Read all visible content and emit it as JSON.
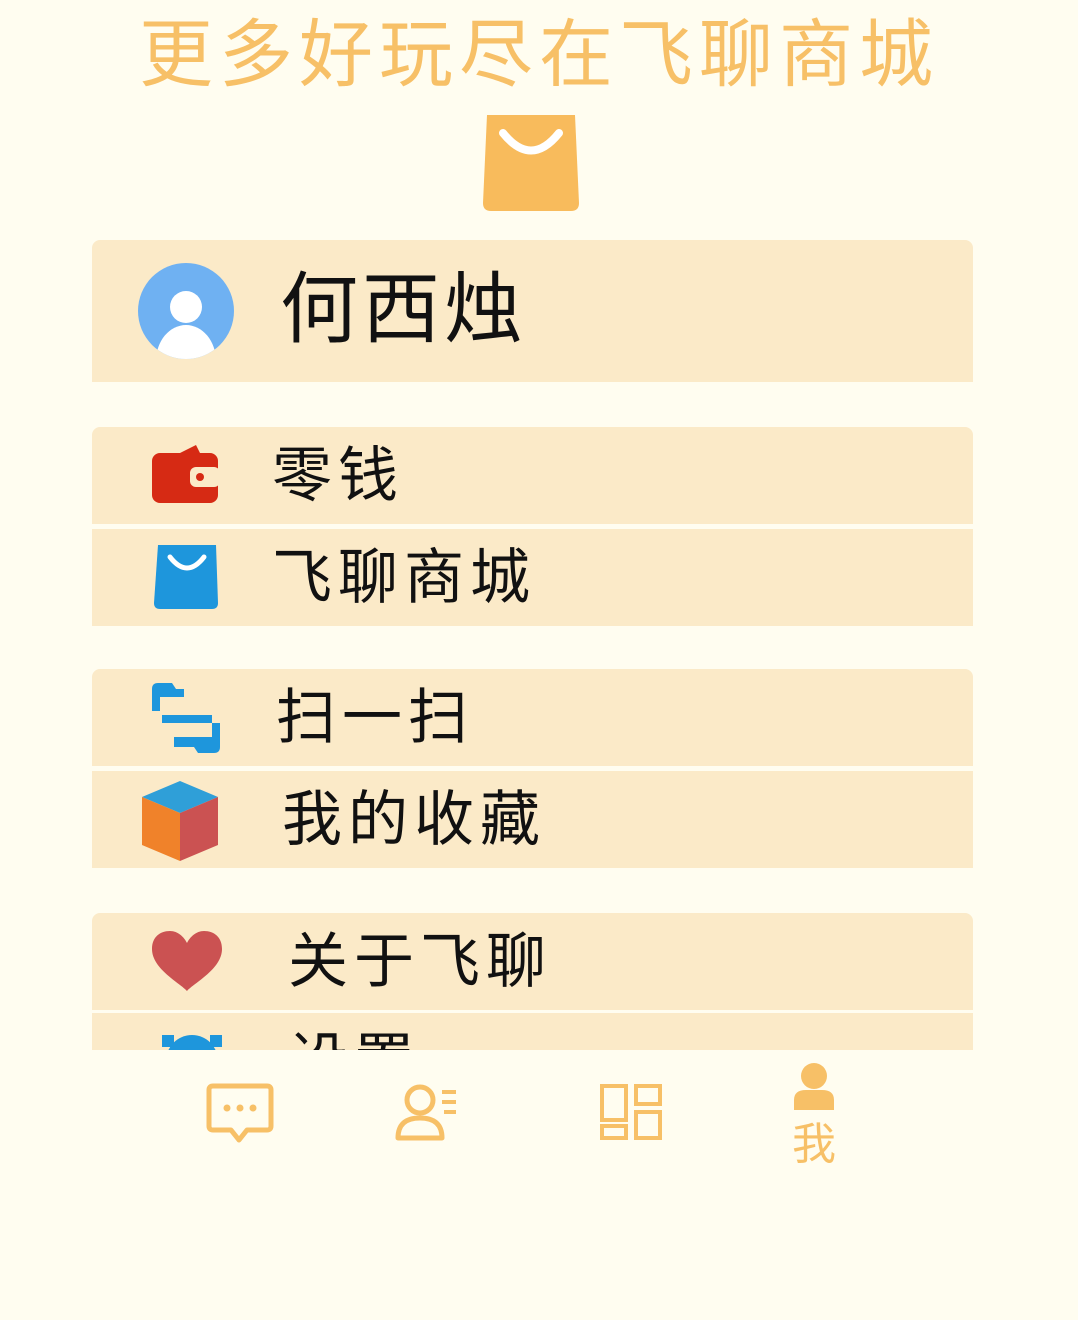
{
  "banner": {
    "title": "更多好玩尽在飞聊商城",
    "icon": "shopping-bag-icon"
  },
  "profile": {
    "name": "何西烛",
    "avatar_icon": "user-avatar-icon"
  },
  "menu": {
    "items": [
      {
        "label": "零钱",
        "icon": "wallet-icon",
        "color": "#d62a14"
      },
      {
        "label": "飞聊商城",
        "icon": "shopping-bag-icon",
        "color": "#1e96dc"
      },
      {
        "label": "扫一扫",
        "icon": "scan-icon",
        "color": "#1e96dc"
      },
      {
        "label": "我的收藏",
        "icon": "cube-icon",
        "color": "#f0822a"
      },
      {
        "label": "关于飞聊",
        "icon": "heart-icon",
        "color": "#cb5252"
      },
      {
        "label": "设置",
        "icon": "settings-icon",
        "color": "#1e96dc"
      }
    ]
  },
  "tabbar": {
    "tabs": [
      {
        "icon": "chat-icon"
      },
      {
        "icon": "contacts-icon"
      },
      {
        "icon": "apps-grid-icon"
      },
      {
        "icon": "me-icon",
        "label": "我",
        "active": true
      }
    ]
  },
  "colors": {
    "accent": "#f7c067",
    "card": "#fbeac8",
    "background": "#fffdf0"
  }
}
